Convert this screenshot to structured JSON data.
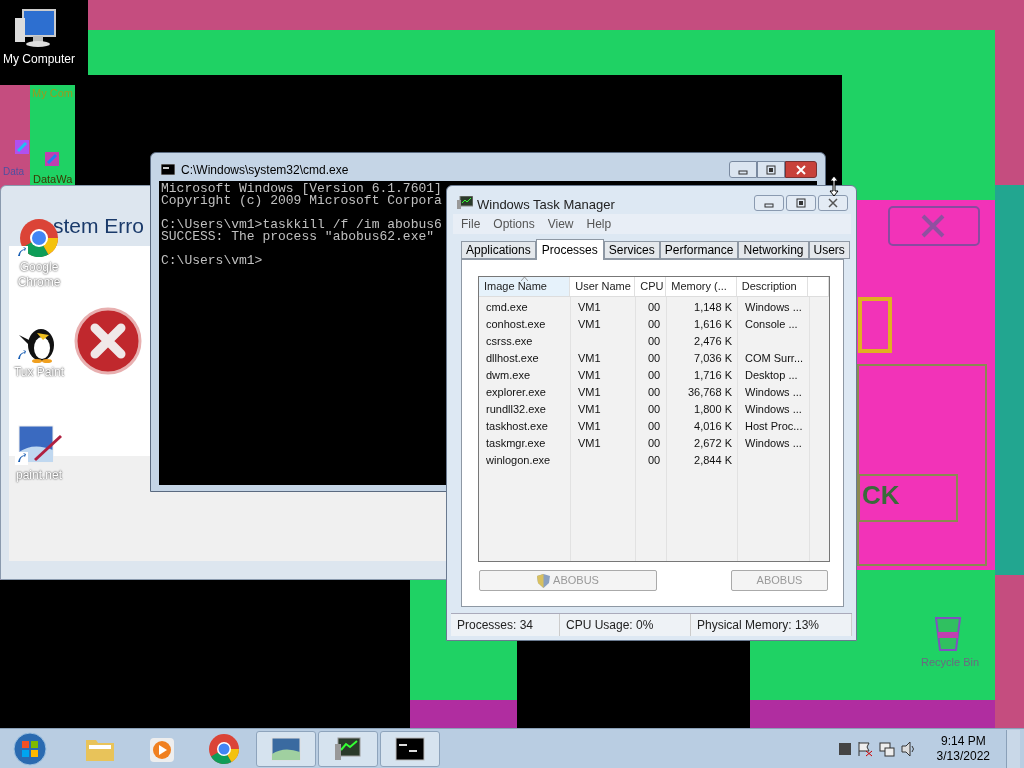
{
  "desktop_icons": [
    {
      "label": "My Computer"
    },
    {
      "label": "Google Chrome"
    },
    {
      "label": "Tux Paint"
    },
    {
      "label": "paint.net"
    },
    {
      "label": "Recycle Bin"
    }
  ],
  "ghost_labels": [
    "My Com",
    "Data",
    "DataWa"
  ],
  "error_window": {
    "title": "stem Erro",
    "button_fragment": "CK"
  },
  "cmd_window": {
    "title": "C:\\Windows\\system32\\cmd.exe",
    "blocks": [
      [
        "Microsoft Windows [Version 6.1.7601]",
        "Copyright (c) 2009 Microsoft Corpora"
      ],
      [
        "C:\\Users\\vm1>taskkill /f /im abobus6",
        "SUCCESS: The process \"abobus62.exe\""
      ],
      [
        "C:\\Users\\vm1>"
      ]
    ]
  },
  "task_manager": {
    "title": "Windows Task Manager",
    "menu": [
      "File",
      "Options",
      "View",
      "Help"
    ],
    "tabs": [
      {
        "label": "Applications",
        "selected": false
      },
      {
        "label": "Processes",
        "selected": true
      },
      {
        "label": "Services",
        "selected": false
      },
      {
        "label": "Performance",
        "selected": false
      },
      {
        "label": "Networking",
        "selected": false
      },
      {
        "label": "Users",
        "selected": false
      }
    ],
    "columns": [
      {
        "label": "Image Name",
        "sorted": true
      },
      {
        "label": "User Name",
        "sorted": false
      },
      {
        "label": "CPU",
        "sorted": false
      },
      {
        "label": "Memory (...",
        "sorted": false
      },
      {
        "label": "Description",
        "sorted": false
      }
    ],
    "rows": [
      [
        "cmd.exe",
        "VM1",
        "00",
        "1,148 K",
        "Windows ..."
      ],
      [
        "conhost.exe",
        "VM1",
        "00",
        "1,616 K",
        "Console ..."
      ],
      [
        "csrss.exe",
        "",
        "00",
        "2,476 K",
        ""
      ],
      [
        "dllhost.exe",
        "VM1",
        "00",
        "7,036 K",
        "COM Surr..."
      ],
      [
        "dwm.exe",
        "VM1",
        "00",
        "1,716 K",
        "Desktop ..."
      ],
      [
        "explorer.exe",
        "VM1",
        "00",
        "36,768 K",
        "Windows ..."
      ],
      [
        "rundll32.exe",
        "VM1",
        "00",
        "1,800 K",
        "Windows ..."
      ],
      [
        "taskhost.exe",
        "VM1",
        "00",
        "4,016 K",
        "Host Proc..."
      ],
      [
        "taskmgr.exe",
        "VM1",
        "00",
        "2,672 K",
        "Windows ..."
      ],
      [
        "winlogon.exe",
        "",
        "00",
        "2,844 K",
        ""
      ]
    ],
    "buttons": [
      {
        "label": "ABOBUS",
        "shield": true,
        "disabled": true
      },
      {
        "label": "ABOBUS",
        "shield": false,
        "disabled": true
      }
    ],
    "status_bar": [
      "Processes: 34",
      "CPU Usage: 0%",
      "Physical Memory: 13%"
    ]
  },
  "taskbar": {
    "items": [
      {
        "kind": "start"
      },
      {
        "kind": "app",
        "active": false
      },
      {
        "kind": "app",
        "active": false
      },
      {
        "kind": "app",
        "active": false
      },
      {
        "kind": "app",
        "active": true
      },
      {
        "kind": "app",
        "active": true
      },
      {
        "kind": "app",
        "active": true
      }
    ],
    "time": "9:14 PM",
    "date": "3/13/2022"
  }
}
